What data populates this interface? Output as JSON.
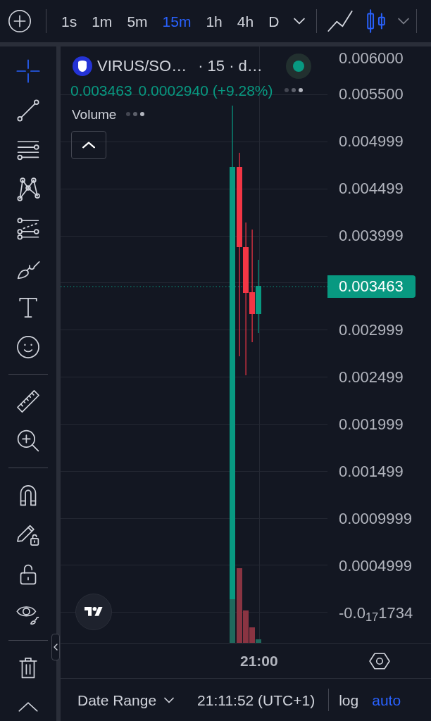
{
  "toolbar": {
    "intervals": [
      {
        "label": "1s",
        "selected": false
      },
      {
        "label": "1m",
        "selected": false
      },
      {
        "label": "5m",
        "selected": false
      },
      {
        "label": "15m",
        "selected": true
      },
      {
        "label": "1h",
        "selected": false
      },
      {
        "label": "4h",
        "selected": false
      },
      {
        "label": "D",
        "selected": false
      }
    ],
    "chart_styles": [
      {
        "kind": "line",
        "selected": false
      },
      {
        "kind": "candles",
        "selected": true
      }
    ]
  },
  "sidebar": {
    "groups": [
      {
        "tools": [
          {
            "kind": "crosshair",
            "selected": true
          },
          {
            "kind": "line",
            "selected": false
          },
          {
            "kind": "levels",
            "selected": false
          },
          {
            "kind": "pattern",
            "selected": false
          },
          {
            "kind": "projection",
            "selected": false
          },
          {
            "kind": "brush",
            "selected": false
          },
          {
            "kind": "text",
            "selected": false
          },
          {
            "kind": "emoji",
            "selected": false
          }
        ]
      },
      {
        "tools": [
          {
            "kind": "ruler",
            "selected": false
          },
          {
            "kind": "zoom",
            "selected": false
          }
        ]
      },
      {
        "tools": [
          {
            "kind": "magnet",
            "selected": false
          },
          {
            "kind": "drawlock",
            "selected": false
          },
          {
            "kind": "lock",
            "selected": false
          },
          {
            "kind": "visibility",
            "selected": false
          }
        ]
      },
      {
        "tools": [
          {
            "kind": "delete",
            "selected": false
          },
          {
            "kind": "more",
            "selected": false
          }
        ]
      }
    ]
  },
  "legend": {
    "symbol": "VIRUS/SO…",
    "details": "· 15 · d…",
    "live": true,
    "price": "0.003463",
    "change": "0.0002940 (+9.28%)",
    "indicators": [
      {
        "name": "Volume"
      }
    ]
  },
  "price_axis": {
    "labels": [
      "0.006000",
      "0.005500",
      "0.004999",
      "0.004499",
      "0.003999",
      "0.002999",
      "0.002499",
      "0.001999",
      "0.001499",
      "0.0009999",
      "0.0004999",
      "-0.0$_{17}$1734"
    ],
    "current_price": "0.003463"
  },
  "time_axis": {
    "labels": [
      "21:00"
    ]
  },
  "status_bar": {
    "date_range": "Date Range",
    "time": "21:11:52 (UTC+1)",
    "scale_options": [
      {
        "label": "log",
        "selected": false
      },
      {
        "label": "auto",
        "selected": true
      }
    ]
  }
}
